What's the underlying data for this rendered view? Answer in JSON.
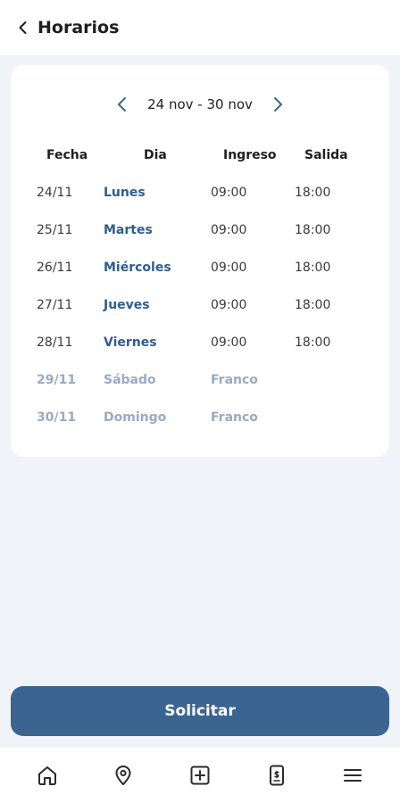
{
  "header": {
    "title": "Horarios",
    "back_icon": "chevron-left-icon"
  },
  "week": {
    "label": "24 nov - 30 nov",
    "prev_icon": "chevron-left-icon",
    "next_icon": "chevron-right-icon"
  },
  "table": {
    "columns": [
      "Fecha",
      "Dia",
      "Ingreso",
      "Salida"
    ],
    "rows": [
      {
        "date": "24/11",
        "day": "Lunes",
        "in": "09:00",
        "out": "18:00",
        "off": false
      },
      {
        "date": "25/11",
        "day": "Martes",
        "in": "09:00",
        "out": "18:00",
        "off": false
      },
      {
        "date": "26/11",
        "day": "Miércoles",
        "in": "09:00",
        "out": "18:00",
        "off": false
      },
      {
        "date": "27/11",
        "day": "Jueves",
        "in": "09:00",
        "out": "18:00",
        "off": false
      },
      {
        "date": "28/11",
        "day": "Viernes",
        "in": "09:00",
        "out": "18:00",
        "off": false
      },
      {
        "date": "29/11",
        "day": "Sábado",
        "in": "Franco",
        "out": "",
        "off": true
      },
      {
        "date": "30/11",
        "day": "Domingo",
        "in": "Franco",
        "out": "",
        "off": true
      }
    ]
  },
  "actions": {
    "solicitar_label": "Solicitar"
  },
  "bottom_nav": {
    "items": [
      {
        "icon": "home-icon"
      },
      {
        "icon": "location-pin-icon"
      },
      {
        "icon": "plus-square-icon"
      },
      {
        "icon": "receipt-icon"
      },
      {
        "icon": "menu-icon"
      }
    ]
  },
  "colors": {
    "accent": "#3b6590",
    "day_text": "#2d5e91",
    "day_off": "#9aaac4",
    "background": "#f0f3f8"
  }
}
